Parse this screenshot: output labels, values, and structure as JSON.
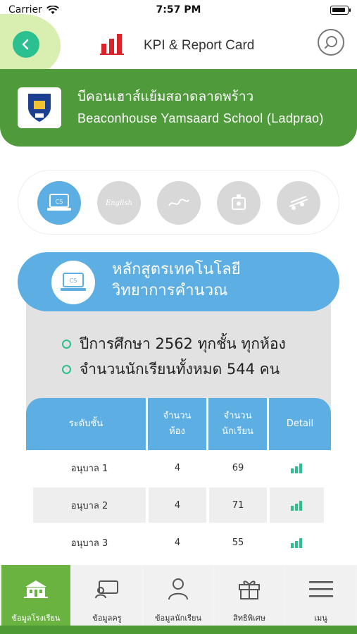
{
  "status_bar": {
    "carrier": "Carrier",
    "time": "7:57 PM"
  },
  "header": {
    "title": "KPI & Report Card",
    "back_icon": "chevron-left-icon",
    "kpi_icon": "bar-chart-icon",
    "search_icon": "search-icon",
    "accent": "#2cbf8f"
  },
  "school": {
    "name_th": "บีคอนเฮาส์แย้มสอาดลาดพร้าว",
    "name_en": "Beaconhouse Yamsaard School (Ladprao)",
    "band_color": "#4f9a3a"
  },
  "courses": [
    {
      "icon": "computer-science-icon",
      "label": "CS",
      "active": true
    },
    {
      "icon": "english-icon",
      "label": "English",
      "active": false
    },
    {
      "icon": "art-icon",
      "label": "",
      "active": false
    },
    {
      "icon": "science-icon",
      "label": "",
      "active": false
    },
    {
      "icon": "music-icon",
      "label": "",
      "active": false
    }
  ],
  "course_detail": {
    "title_line1": "หลักสูตรเทคโนโลยี",
    "title_line2": "วิทยาการคำนวณ",
    "icon_label": "CS",
    "info": [
      "ปีการศึกษา 2562 ทุกชั้น ทุกห้อง",
      "จำนวนนักเรียนทั้งหมด 544 คน"
    ]
  },
  "table": {
    "headers": {
      "level": "ระดับชั้น",
      "rooms_1": "จำนวน",
      "rooms_2": "ห้อง",
      "students_1": "จำนวน",
      "students_2": "นักเรียน",
      "detail": "Detail"
    },
    "rows": [
      {
        "level": "อนุบาล 1",
        "rooms": "4",
        "students": "69"
      },
      {
        "level": "อนุบาล 2",
        "rooms": "4",
        "students": "71"
      },
      {
        "level": "อนุบาล 3",
        "rooms": "4",
        "students": "55"
      }
    ]
  },
  "tabs": [
    {
      "label": "ข้อมูลโรงเรียน",
      "icon": "school-icon",
      "active": true
    },
    {
      "label": "ข้อมูลครู",
      "icon": "teacher-icon",
      "active": false
    },
    {
      "label": "ข้อมูลนักเรียน",
      "icon": "student-icon",
      "active": false
    },
    {
      "label": "สิทธิพิเศษ",
      "icon": "gift-icon",
      "active": false
    },
    {
      "label": "เมนู",
      "icon": "menu-icon",
      "active": false
    }
  ]
}
